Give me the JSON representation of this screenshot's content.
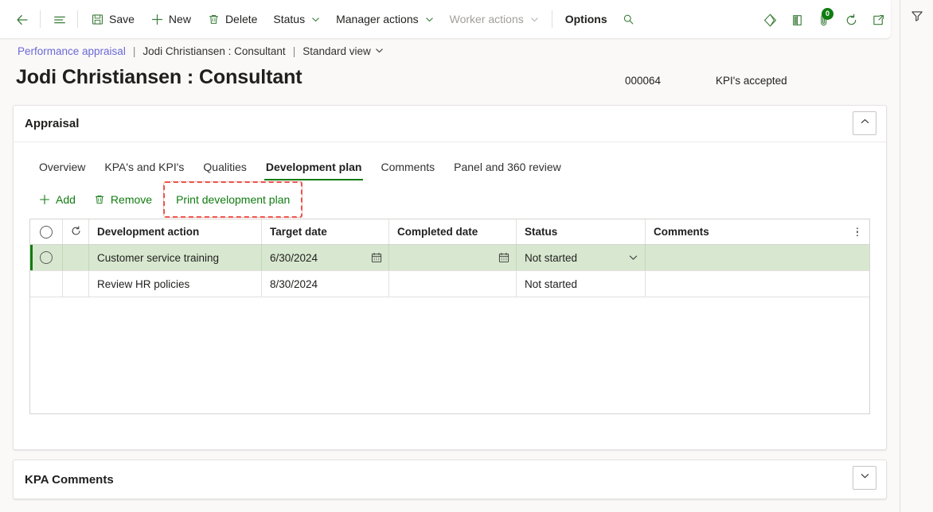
{
  "commandbar": {
    "back_label": "Back",
    "nav_label": "Show navigation pane",
    "save_label": "Save",
    "new_label": "New",
    "delete_label": "Delete",
    "status_label": "Status",
    "manager_actions_label": "Manager actions",
    "worker_actions_label": "Worker actions",
    "options_label": "Options",
    "search_label": "Search",
    "icons": {
      "back": "back-arrow-icon",
      "nav": "hamburger-menu-icon",
      "save": "save-floppy-icon",
      "new": "plus-icon",
      "delete": "trash-icon",
      "search": "search-icon",
      "diamond": "dynamics-diamond-icon",
      "panel": "show-hide-panel-icon",
      "attachment": "attachment-icon",
      "refresh": "refresh-icon",
      "popout": "open-in-new-window-icon",
      "filter": "filter-funnel-icon"
    },
    "attachment_badge": "0"
  },
  "breadcrumb": {
    "module": "Performance appraisal",
    "separator": "|",
    "record": "Jodi Christiansen : Consultant",
    "view": "Standard view"
  },
  "header": {
    "title": "Jodi Christiansen : Consultant",
    "record_id": "000064",
    "status": "KPI's accepted"
  },
  "appraisal": {
    "title": "Appraisal",
    "collapse_tooltip": "Collapse",
    "tabs": [
      {
        "label": "Overview",
        "active": false
      },
      {
        "label": "KPA's and KPI's",
        "active": false
      },
      {
        "label": "Qualities",
        "active": false
      },
      {
        "label": "Development plan",
        "active": true
      },
      {
        "label": "Comments",
        "active": false
      },
      {
        "label": "Panel and 360 review",
        "active": false
      }
    ],
    "toolbar": {
      "add_label": "Add",
      "remove_label": "Remove",
      "print_label": "Print development plan"
    },
    "grid": {
      "columns": [
        {
          "key": "select",
          "label": ""
        },
        {
          "key": "indicator",
          "label": ""
        },
        {
          "key": "action",
          "label": "Development action"
        },
        {
          "key": "target",
          "label": "Target date"
        },
        {
          "key": "completed",
          "label": "Completed date"
        },
        {
          "key": "status",
          "label": "Status"
        },
        {
          "key": "comments",
          "label": "Comments"
        }
      ],
      "rows": [
        {
          "action": "Customer service training",
          "target": "6/30/2024",
          "completed": "",
          "status": "Not started",
          "comments": "",
          "selected": true
        },
        {
          "action": "Review HR policies",
          "target": "8/30/2024",
          "completed": "",
          "status": "Not started",
          "comments": "",
          "selected": false
        }
      ]
    }
  },
  "kpa_comments": {
    "title": "KPA Comments",
    "expand_tooltip": "Expand"
  },
  "colors": {
    "accent_green": "#107c10",
    "link_purple": "#6b69d6",
    "selected_row": "#d8e8d0",
    "annotation_red": "#e8493f"
  }
}
